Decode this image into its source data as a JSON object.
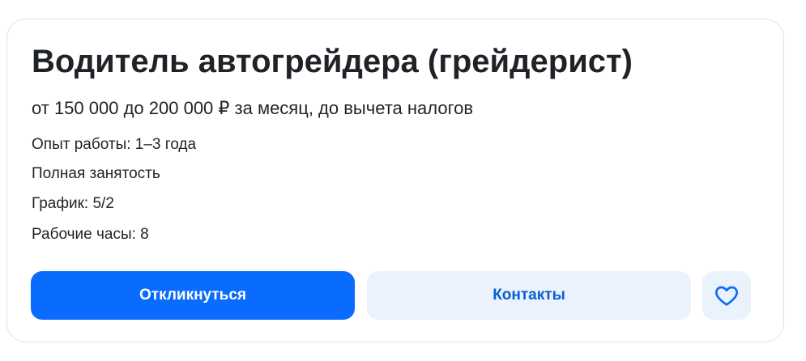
{
  "vacancy": {
    "title": "Водитель автогрейдера (грейдерист)",
    "salary": "от 150 000 до 200 000 ₽ за месяц, до вычета налогов",
    "details": [
      "Опыт работы: 1–3 года",
      "Полная занятость",
      "График: 5/2",
      "Рабочие часы: 8"
    ]
  },
  "actions": {
    "respond_label": "Откликнуться",
    "contacts_label": "Контакты",
    "favorite_icon": "heart-icon"
  },
  "colors": {
    "accent": "#0a6cff",
    "secondary_bg": "#eaf2fb",
    "secondary_text": "#0a5cd6",
    "text": "#1f2328"
  }
}
